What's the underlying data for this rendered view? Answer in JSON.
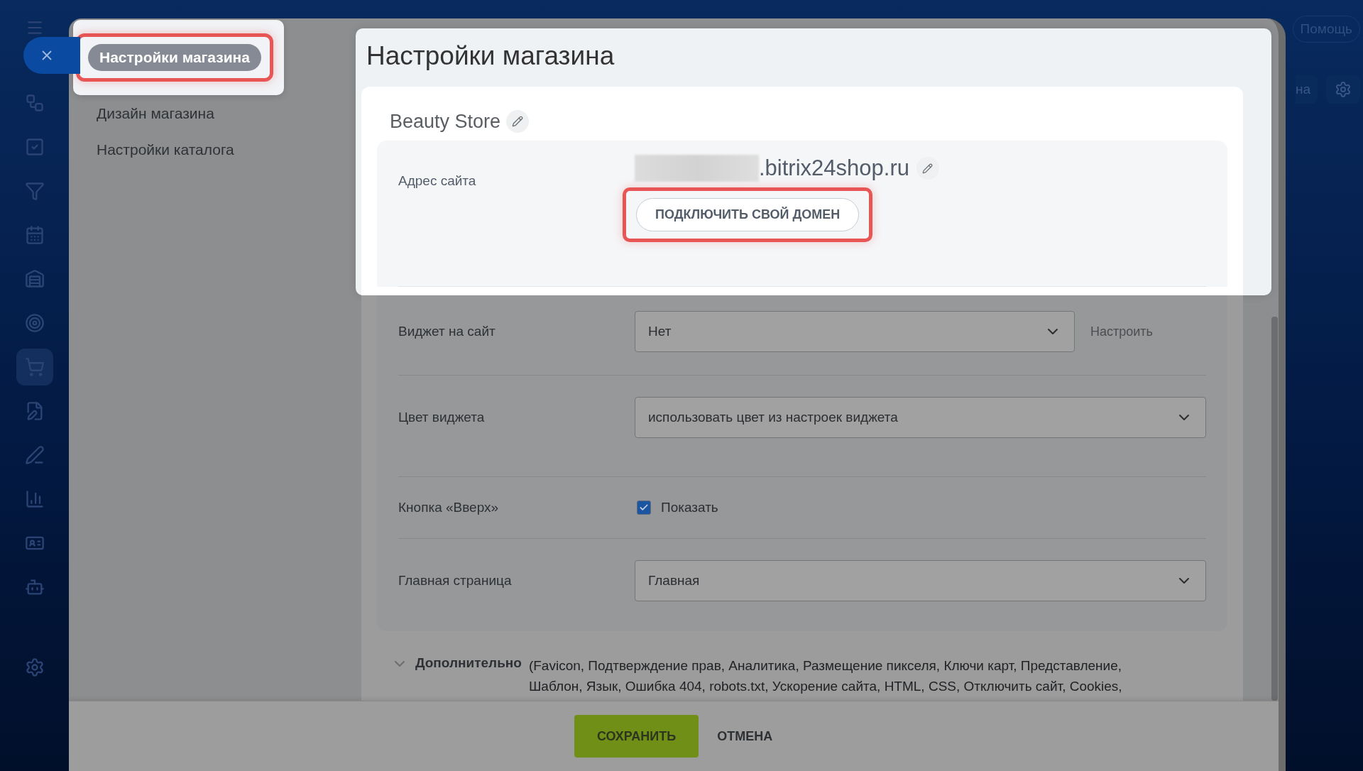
{
  "topbar": {
    "help": "Помощь",
    "partial_button": "на"
  },
  "menu": [
    {
      "label": "Настройки магазина",
      "selected": true
    },
    {
      "label": "Дизайн магазина",
      "selected": false
    },
    {
      "label": "Настройки каталога",
      "selected": false
    }
  ],
  "title": "Настройки магазина",
  "store": {
    "name": "Beauty Store",
    "address_label": "Адрес сайта",
    "domain": ".bitrix24shop.ru",
    "connect_button": "ПОДКЛЮЧИТЬ СВОЙ ДОМЕН"
  },
  "rows": [
    {
      "kind": "select",
      "label": "Виджет на сайт",
      "value": "Нет",
      "link": "Настроить"
    },
    {
      "kind": "select",
      "label": "Цвет виджета",
      "value": "использовать цвет из настроек виджета"
    },
    {
      "kind": "checkbox",
      "label": "Кнопка «Вверх»",
      "value": "Показать",
      "checked": true
    },
    {
      "kind": "select",
      "label": "Главная страница",
      "value": "Главная"
    }
  ],
  "extra": {
    "label": "Дополнительно",
    "text": "(Favicon, Подтверждение прав, Аналитика, Размещение пикселя, Ключи карт, Представление, Шаблон, Язык, Ошибка 404, robots.txt, Ускорение сайта, HTML, CSS, Отключить сайт, Cookies,"
  },
  "footer": {
    "save": "СОХРАНИТЬ",
    "cancel": "ОТМЕНА"
  }
}
